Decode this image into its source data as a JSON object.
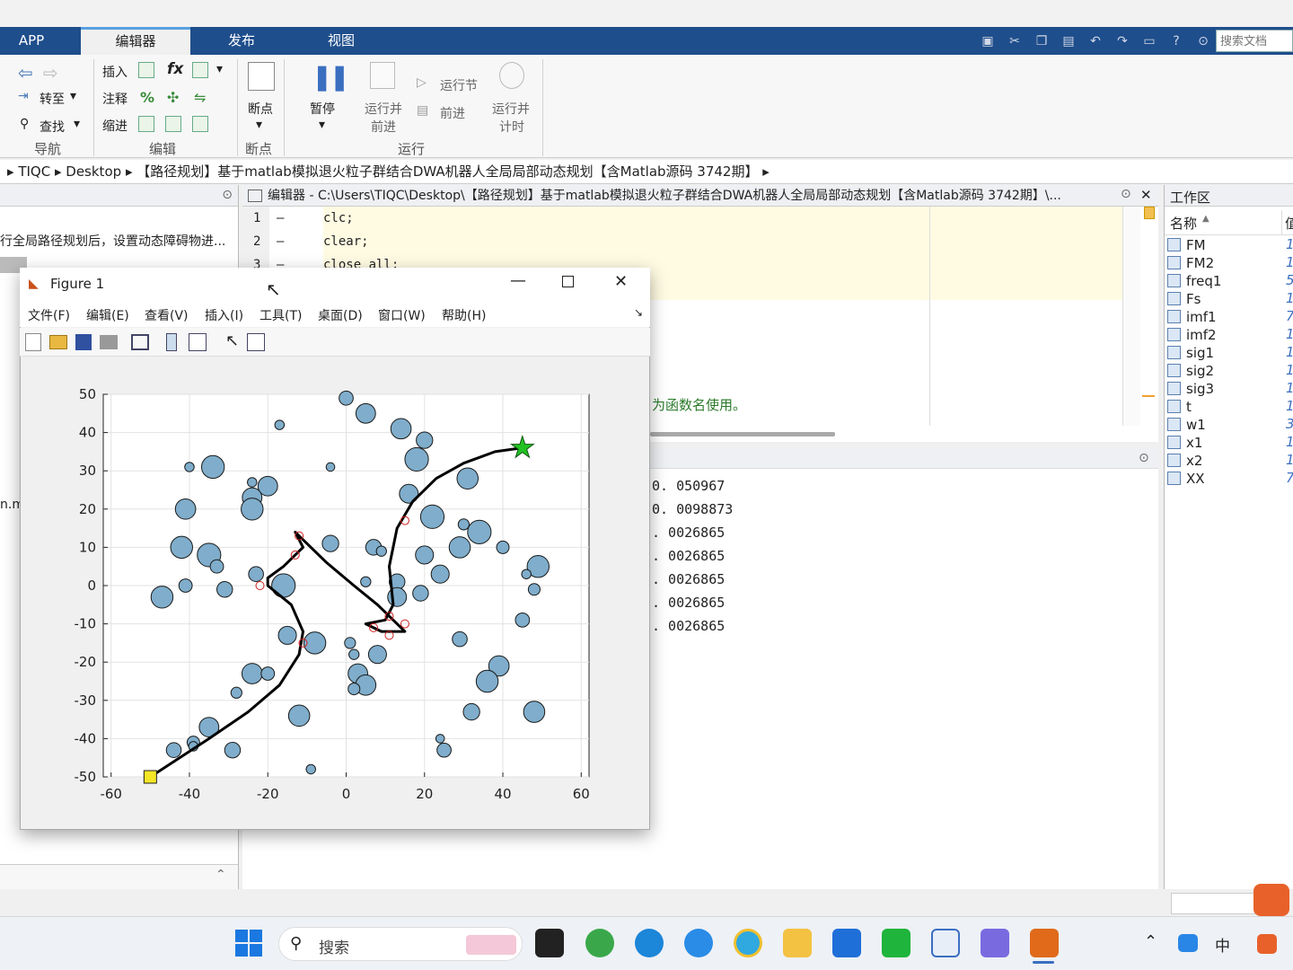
{
  "tabs": {
    "app": "APP",
    "editor": "编辑器",
    "publish": "发布",
    "view": "视图"
  },
  "search_doc": {
    "placeholder": "搜索文档"
  },
  "ribbon": {
    "nav": {
      "goto": "转至",
      "find": "查找",
      "group": "导航"
    },
    "edit": {
      "insert": "插入",
      "comment": "注释",
      "indent": "缩进",
      "fx": "fx",
      "group": "编辑"
    },
    "breakpoint": {
      "label": "断点",
      "group": "断点"
    },
    "run": {
      "pause": "暂停",
      "run_advance_1": "运行并",
      "run_advance_2": "前进",
      "run_section": "运行节",
      "advance": "前进",
      "run_time_1": "运行并",
      "run_time_2": "计时",
      "group": "运行"
    }
  },
  "address": {
    "parts": [
      "TIQC",
      "Desktop",
      "【路径规划】基于matlab模拟退火粒子群结合DWA机器人全局局部动态规划【含Matlab源码 3742期】"
    ]
  },
  "left_panel": {
    "desc": "行全局路径规划后，设置动态障碍物进...",
    "file_frag": "n.m"
  },
  "editor": {
    "title": "编辑器 - C:\\Users\\TIQC\\Desktop\\【路径规划】基于matlab模拟退火粒子群结合DWA机器人全局局部动态规划【含Matlab源码 3742期】\\...",
    "lines": [
      {
        "num": "1",
        "code": "clc;"
      },
      {
        "num": "2",
        "code": "clear;"
      },
      {
        "num": "3",
        "code": "close all;"
      }
    ],
    "msg": "为函数名使用。"
  },
  "command_window": {
    "values": [
      "0. 050967",
      "0. 0098873",
      ". 0026865",
      ". 0026865",
      ". 0026865",
      ". 0026865",
      ". 0026865"
    ]
  },
  "workspace": {
    "title": "工作区",
    "col_name": "名称",
    "col_value": "值",
    "vars": [
      {
        "name": "FM",
        "v": "1"
      },
      {
        "name": "FM2",
        "v": "1"
      },
      {
        "name": "freq1",
        "v": "5"
      },
      {
        "name": "Fs",
        "v": "1"
      },
      {
        "name": "imf1",
        "v": "7"
      },
      {
        "name": "imf2",
        "v": "1"
      },
      {
        "name": "sig1",
        "v": "1"
      },
      {
        "name": "sig2",
        "v": "1"
      },
      {
        "name": "sig3",
        "v": "1"
      },
      {
        "name": "t",
        "v": "1"
      },
      {
        "name": "w1",
        "v": "3"
      },
      {
        "name": "x1",
        "v": "1"
      },
      {
        "name": "x2",
        "v": "1"
      },
      {
        "name": "XX",
        "v": "7"
      }
    ]
  },
  "figure": {
    "title": "Figure 1",
    "menu": [
      "文件(F)",
      "编辑(E)",
      "查看(V)",
      "插入(I)",
      "工具(T)",
      "桌面(D)",
      "窗口(W)",
      "帮助(H)"
    ]
  },
  "chart_data": {
    "type": "scatter",
    "xlim": [
      -62,
      62
    ],
    "ylim": [
      -50,
      50
    ],
    "xticks": [
      -60,
      -40,
      -20,
      0,
      20,
      40,
      60
    ],
    "yticks": [
      50,
      40,
      30,
      20,
      10,
      0,
      -10,
      -20,
      -30,
      -40,
      -50
    ],
    "grid": true,
    "obstacle_color": "#7fadcb",
    "obstacles": [
      [
        0,
        49,
        1.8
      ],
      [
        5,
        45,
        2.5
      ],
      [
        -17,
        42,
        1.2
      ],
      [
        14,
        41,
        2.6
      ],
      [
        20,
        38,
        2.1
      ],
      [
        -40,
        31,
        1.2
      ],
      [
        -34,
        31,
        2.9
      ],
      [
        -4,
        31,
        1.1
      ],
      [
        18,
        33,
        3.0
      ],
      [
        31,
        28,
        2.7
      ],
      [
        -20,
        26,
        2.5
      ],
      [
        -24,
        27,
        1.2
      ],
      [
        -24,
        23,
        2.5
      ],
      [
        -24,
        20,
        2.8
      ],
      [
        -41,
        20,
        2.6
      ],
      [
        16,
        24,
        2.4
      ],
      [
        22,
        18,
        3.0
      ],
      [
        30,
        16,
        1.4
      ],
      [
        34,
        14,
        3.0
      ],
      [
        -42,
        10,
        2.8
      ],
      [
        -35,
        8,
        3.0
      ],
      [
        -33,
        5,
        1.7
      ],
      [
        -4,
        11,
        2.1
      ],
      [
        7,
        10,
        2.0
      ],
      [
        9,
        9,
        1.3
      ],
      [
        20,
        8,
        2.3
      ],
      [
        29,
        10,
        2.7
      ],
      [
        40,
        10,
        1.6
      ],
      [
        -23,
        3,
        1.9
      ],
      [
        24,
        3,
        2.3
      ],
      [
        49,
        5,
        2.8
      ],
      [
        46,
        3,
        1.2
      ],
      [
        -41,
        0,
        1.7
      ],
      [
        -31,
        -1,
        2.0
      ],
      [
        -16,
        0,
        3.0
      ],
      [
        5,
        1,
        1.3
      ],
      [
        13,
        1,
        2.0
      ],
      [
        19,
        -2,
        2.0
      ],
      [
        48,
        -1,
        1.5
      ],
      [
        -47,
        -3,
        2.8
      ],
      [
        13,
        -3,
        2.4
      ],
      [
        -15,
        -13,
        2.3
      ],
      [
        -8,
        -15,
        2.8
      ],
      [
        1,
        -15,
        1.4
      ],
      [
        2,
        -18,
        1.3
      ],
      [
        8,
        -18,
        2.3
      ],
      [
        29,
        -14,
        1.9
      ],
      [
        45,
        -9,
        1.8
      ],
      [
        -24,
        -23,
        2.6
      ],
      [
        -20,
        -23,
        1.7
      ],
      [
        3,
        -23,
        2.5
      ],
      [
        5,
        -26,
        2.6
      ],
      [
        2,
        -27,
        1.5
      ],
      [
        -28,
        -28,
        1.4
      ],
      [
        39,
        -21,
        2.6
      ],
      [
        36,
        -25,
        2.8
      ],
      [
        -12,
        -34,
        2.7
      ],
      [
        -35,
        -37,
        2.5
      ],
      [
        -39,
        -41,
        1.6
      ],
      [
        -39,
        -42,
        1.2
      ],
      [
        -44,
        -43,
        1.9
      ],
      [
        -29,
        -43,
        2.0
      ],
      [
        24,
        -40,
        1.1
      ],
      [
        25,
        -43,
        1.8
      ],
      [
        -9,
        -48,
        1.2
      ],
      [
        32,
        -33,
        2.1
      ],
      [
        48,
        -33,
        2.7
      ]
    ],
    "start": [
      -50,
      -50
    ],
    "goal": [
      45,
      36
    ],
    "path": [
      [
        -50,
        -50
      ],
      [
        -44,
        -46
      ],
      [
        -35,
        -40
      ],
      [
        -25,
        -33
      ],
      [
        -17,
        -26
      ],
      [
        -12,
        -18
      ],
      [
        -11,
        -12
      ],
      [
        -14,
        -5
      ],
      [
        -20,
        0
      ],
      [
        -20,
        2
      ],
      [
        -16,
        5
      ],
      [
        -11,
        10
      ],
      [
        -13,
        14
      ],
      [
        -5,
        6
      ],
      [
        2,
        0
      ],
      [
        8,
        -5
      ],
      [
        12,
        -9
      ],
      [
        15,
        -12
      ],
      [
        9,
        -12
      ],
      [
        5,
        -10
      ],
      [
        10,
        -9
      ],
      [
        12,
        -5
      ],
      [
        11,
        5
      ],
      [
        13,
        15
      ],
      [
        17,
        22
      ],
      [
        23,
        28
      ],
      [
        30,
        32
      ],
      [
        38,
        35
      ],
      [
        45,
        36
      ]
    ],
    "dwa_markers": [
      [
        -12,
        13
      ],
      [
        -13,
        8
      ],
      [
        -22,
        0
      ],
      [
        -11,
        -15
      ],
      [
        7,
        -11
      ],
      [
        11,
        -8
      ],
      [
        11,
        -13
      ],
      [
        15,
        -10
      ],
      [
        15,
        17
      ]
    ]
  },
  "taskbar": {
    "search": "搜索",
    "ime": "中"
  },
  "colors": {
    "tabbar": "#1f4e8c",
    "goal": "#22c222",
    "start": "#f5e626",
    "path": "#000000",
    "marker": "#d02020"
  }
}
